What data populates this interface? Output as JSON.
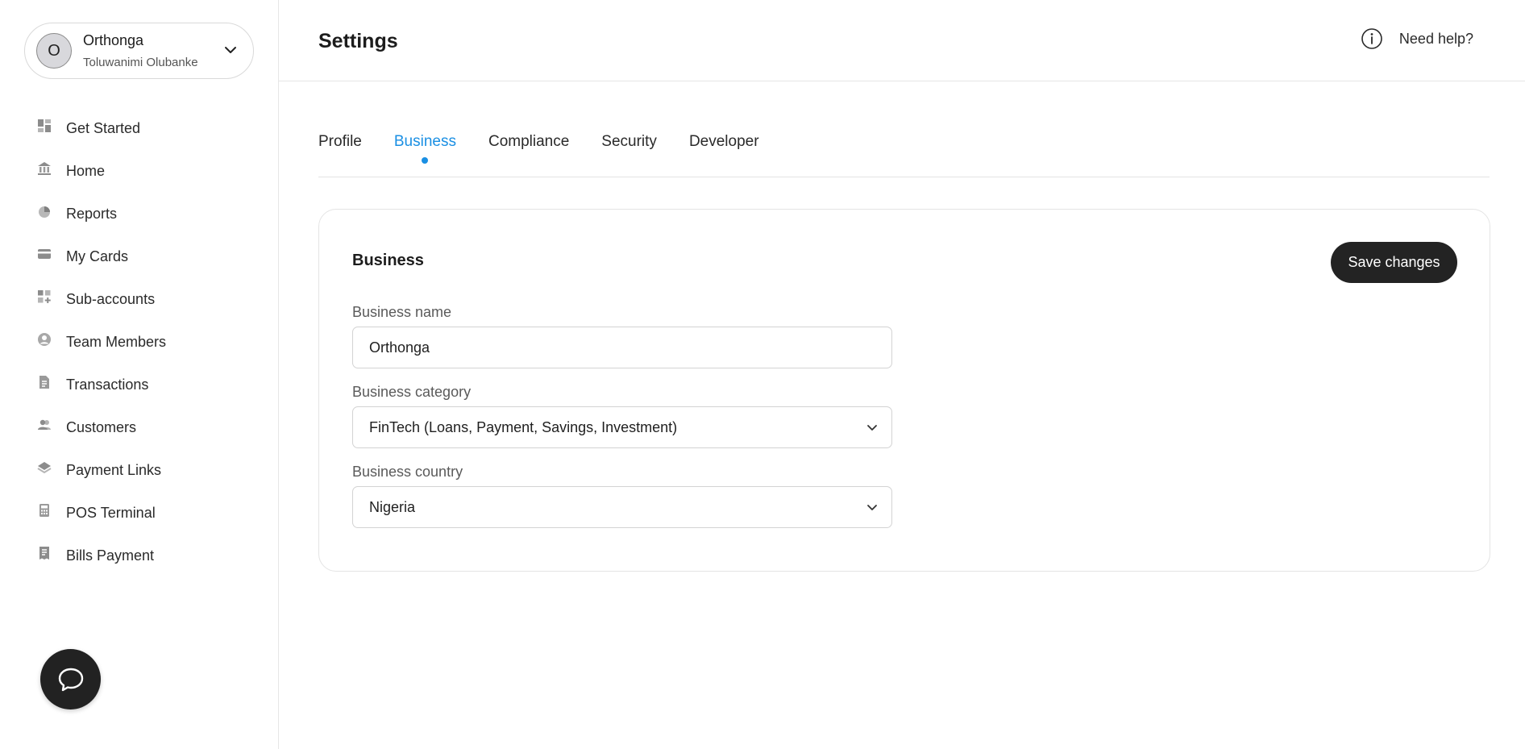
{
  "account": {
    "initial": "O",
    "name": "Orthonga",
    "user": "Toluwanimi Olubanke"
  },
  "sidebar": {
    "items": [
      {
        "label": "Get Started",
        "icon": "grid-icon"
      },
      {
        "label": "Home",
        "icon": "bank-icon"
      },
      {
        "label": "Reports",
        "icon": "pie-chart-icon"
      },
      {
        "label": "My Cards",
        "icon": "card-icon"
      },
      {
        "label": "Sub-accounts",
        "icon": "grid-plus-icon"
      },
      {
        "label": "Team Members",
        "icon": "user-circle-icon"
      },
      {
        "label": "Transactions",
        "icon": "document-icon"
      },
      {
        "label": "Customers",
        "icon": "users-icon"
      },
      {
        "label": "Payment Links",
        "icon": "layers-icon"
      },
      {
        "label": "POS Terminal",
        "icon": "calculator-icon"
      },
      {
        "label": "Bills Payment",
        "icon": "receipt-icon"
      }
    ]
  },
  "header": {
    "title": "Settings",
    "help_label": "Need help?"
  },
  "tabs": [
    {
      "label": "Profile",
      "active": false
    },
    {
      "label": "Business",
      "active": true
    },
    {
      "label": "Compliance",
      "active": false
    },
    {
      "label": "Security",
      "active": false
    },
    {
      "label": "Developer",
      "active": false
    }
  ],
  "card": {
    "title": "Business",
    "save_label": "Save changes",
    "business_name": {
      "label": "Business name",
      "value": "Orthonga"
    },
    "business_category": {
      "label": "Business category",
      "value": "FinTech (Loans, Payment, Savings, Investment)"
    },
    "business_country": {
      "label": "Business country",
      "value": "Nigeria"
    }
  },
  "colors": {
    "accent": "#1a8fe3",
    "button_dark": "#232323",
    "icon_gray": "#8c8c8c"
  }
}
